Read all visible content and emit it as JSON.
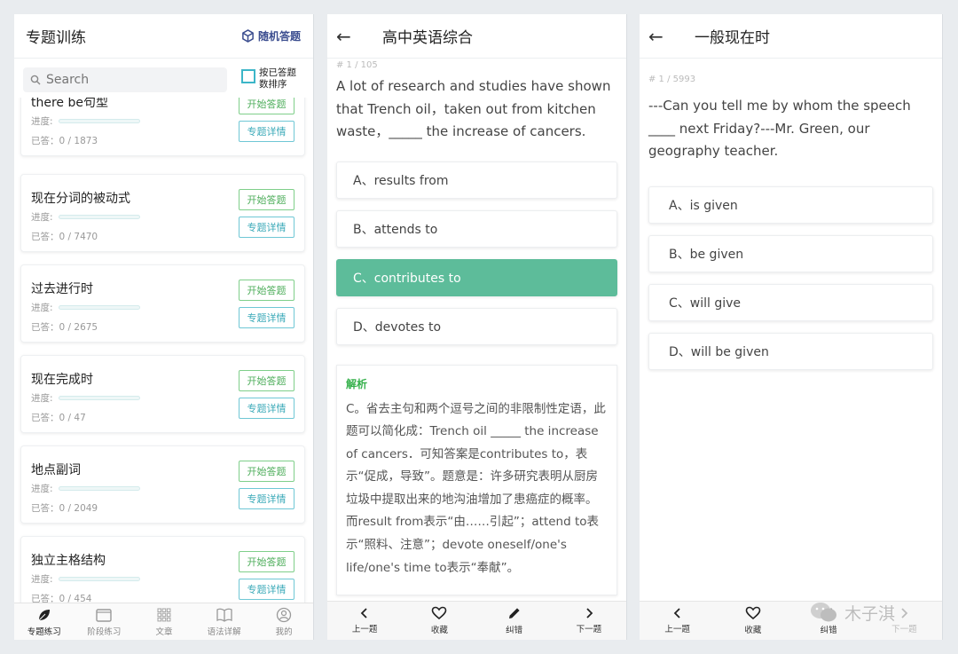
{
  "panel1": {
    "title": "专题训练",
    "random_label": "随机答题",
    "search_placeholder": "Search",
    "sort_label": "按已答题数排序",
    "cards": [
      {
        "title": "there be句型",
        "progress_label": "进度:",
        "answered": "已答：0 / 1873",
        "start": "开始答题",
        "detail": "专题详情"
      },
      {
        "title": "现在分词的被动式",
        "progress_label": "进度:",
        "answered": "已答：0 / 7470",
        "start": "开始答题",
        "detail": "专题详情"
      },
      {
        "title": "过去进行时",
        "progress_label": "进度:",
        "answered": "已答：0 / 2675",
        "start": "开始答题",
        "detail": "专题详情"
      },
      {
        "title": "现在完成时",
        "progress_label": "进度:",
        "answered": "已答：0 / 47",
        "start": "开始答题",
        "detail": "专题详情"
      },
      {
        "title": "地点副词",
        "progress_label": "进度:",
        "answered": "已答：0 / 2049",
        "start": "开始答题",
        "detail": "专题详情"
      },
      {
        "title": "独立主格结构",
        "progress_label": "进度:",
        "answered": "已答：0 / 454",
        "start": "开始答题",
        "detail": "专题详情"
      }
    ],
    "tabs": [
      {
        "label": "专题练习",
        "icon": "leaf-icon"
      },
      {
        "label": "阶段练习",
        "icon": "folder-icon"
      },
      {
        "label": "文章",
        "icon": "grid-icon"
      },
      {
        "label": "语法详解",
        "icon": "book-icon"
      },
      {
        "label": "我的",
        "icon": "user-icon"
      }
    ]
  },
  "panel2": {
    "title": "高中英语综合",
    "qnum": "# 1 / 105",
    "question": "A lot of research and studies have shown that Trench oil，taken out from kitchen waste，_____ the increase of cancers.",
    "options": [
      "A、results from",
      "B、attends to",
      "C、contributes to",
      "D、devotes to"
    ],
    "selected_index": 2,
    "explanation_heading": "解析",
    "explanation": "C。省去主句和两个逗号之间的非限制性定语，此题可以简化成：Trench oil _____ the increase of cancers．可知答案是contributes to，表示“促成，导致”。题意是：许多研究表明从厨房垃圾中提取出来的地沟油增加了患癌症的概率。而result from表示“由……引起”；attend to表示“照料、注意”；devote oneself/one's life/one's time to表示“奉献”。",
    "actions": [
      "上一题",
      "收藏",
      "纠错",
      "下一题"
    ]
  },
  "panel3": {
    "title": "一般现在时",
    "qnum": "# 1 / 5993",
    "question": "---Can you tell me by whom the speech ____ next Friday?---Mr. Green, our geography teacher.",
    "options": [
      "A、is given",
      "B、be given",
      "C、will give",
      "D、will be given"
    ],
    "actions": [
      "上一题",
      "收藏",
      "纠错",
      "下一题"
    ]
  },
  "watermark": "木子淇",
  "colors": {
    "selected": "#5dbc9a",
    "start_button": "#4fae5c",
    "detail_button": "#3aa9b8",
    "explanation_heading": "#36b14c"
  }
}
